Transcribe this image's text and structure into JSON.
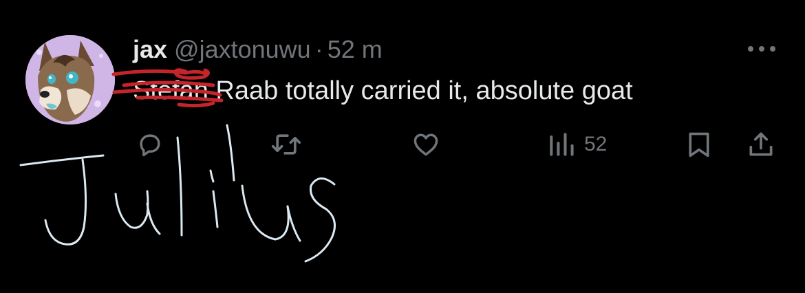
{
  "tweet": {
    "display_name": "jax",
    "handle": "@jaxtonuwu",
    "separator": "·",
    "time": "52 m",
    "text_struck": "Stefan",
    "text_rest": " Raab totally carried it, absolute goat",
    "views_count": "52"
  },
  "annotation": {
    "handwritten_text": "Julius",
    "ink_color": "#dbe9f2",
    "strike_color": "#c5252a"
  },
  "icons": {
    "more": "more-horizontal-icon",
    "reply": "reply-icon",
    "retweet": "retweet-icon",
    "like": "like-icon",
    "views": "views-icon",
    "bookmark": "bookmark-icon",
    "share": "share-icon"
  },
  "colors": {
    "background": "#000000",
    "primary_text": "#e7e9ea",
    "secondary_text": "#71767b"
  }
}
